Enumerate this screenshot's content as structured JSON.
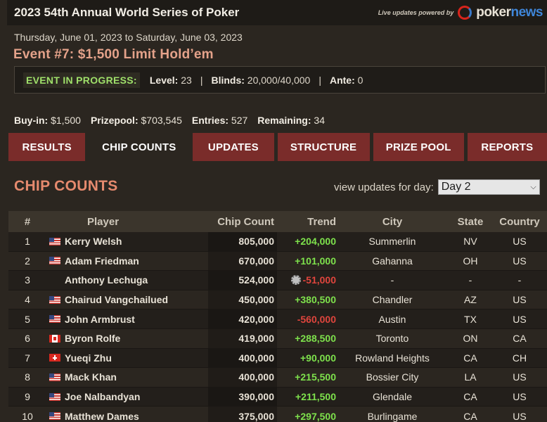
{
  "header": {
    "title": "2023 54th Annual World Series of Poker",
    "tagline": "Live updates powered by",
    "logo_part1": "poker",
    "logo_part2": "news"
  },
  "event": {
    "dates": "Thursday, June 01, 2023 to Saturday, June 03, 2023",
    "title": "Event #7: $1,500 Limit Hold’em",
    "status_badge": "EVENT IN PROGRESS:",
    "level_label": "Level:",
    "level_value": "23",
    "blinds_label": "Blinds:",
    "blinds_value": "20,000/40,000",
    "ante_label": "Ante:",
    "ante_value": "0",
    "separator": "|"
  },
  "stats": {
    "buyin_label": "Buy-in:",
    "buyin_value": "$1,500",
    "prizepool_label": "Prizepool:",
    "prizepool_value": "$703,545",
    "entries_label": "Entries:",
    "entries_value": "527",
    "remaining_label": "Remaining:",
    "remaining_value": "34"
  },
  "nav": {
    "tabs": [
      "RESULTS",
      "CHIP COUNTS",
      "UPDATES",
      "STRUCTURE",
      "PRIZE POOL",
      "REPORTS"
    ],
    "active": "CHIP COUNTS"
  },
  "chipcounts": {
    "section_title": "CHIP COUNTS",
    "day_label": "view updates for day:",
    "day_selected": "Day 2",
    "columns": [
      "#",
      "Player",
      "Chip Count",
      "Trend",
      "City",
      "State",
      "Country"
    ],
    "rows": [
      {
        "rank": "1",
        "flag": "us",
        "player": "Kerry Welsh",
        "chips": "805,000",
        "trend": "+204,000",
        "dir": "up",
        "city": "Summerlin",
        "state": "NV",
        "country": "US"
      },
      {
        "rank": "2",
        "flag": "us",
        "player": "Adam Friedman",
        "chips": "670,000",
        "trend": "+101,000",
        "dir": "up",
        "city": "Gahanna",
        "state": "OH",
        "country": "US"
      },
      {
        "rank": "3",
        "flag": "none",
        "player": "Anthony Lechuga",
        "chips": "524,000",
        "trend": "-51,000",
        "dir": "down",
        "chip_icon": true,
        "city": "-",
        "state": "-",
        "country": "-"
      },
      {
        "rank": "4",
        "flag": "us",
        "player": "Chairud Vangchailued",
        "chips": "450,000",
        "trend": "+380,500",
        "dir": "up",
        "city": "Chandler",
        "state": "AZ",
        "country": "US"
      },
      {
        "rank": "5",
        "flag": "us",
        "player": "John Armbrust",
        "chips": "420,000",
        "trend": "-560,000",
        "dir": "down",
        "city": "Austin",
        "state": "TX",
        "country": "US"
      },
      {
        "rank": "6",
        "flag": "ca",
        "player": "Byron Rolfe",
        "chips": "419,000",
        "trend": "+288,500",
        "dir": "up",
        "city": "Toronto",
        "state": "ON",
        "country": "CA"
      },
      {
        "rank": "7",
        "flag": "ch",
        "player": "Yueqi Zhu",
        "chips": "400,000",
        "trend": "+90,000",
        "dir": "up",
        "city": "Rowland Heights",
        "state": "CA",
        "country": "CH"
      },
      {
        "rank": "8",
        "flag": "us",
        "player": "Mack Khan",
        "chips": "400,000",
        "trend": "+215,500",
        "dir": "up",
        "city": "Bossier City",
        "state": "LA",
        "country": "US"
      },
      {
        "rank": "9",
        "flag": "us",
        "player": "Joe Nalbandyan",
        "chips": "390,000",
        "trend": "+211,500",
        "dir": "up",
        "city": "Glendale",
        "state": "CA",
        "country": "US"
      },
      {
        "rank": "10",
        "flag": "us",
        "player": "Matthew Dames",
        "chips": "375,000",
        "trend": "+297,500",
        "dir": "up",
        "city": "Burlingame",
        "state": "CA",
        "country": "US"
      }
    ]
  }
}
